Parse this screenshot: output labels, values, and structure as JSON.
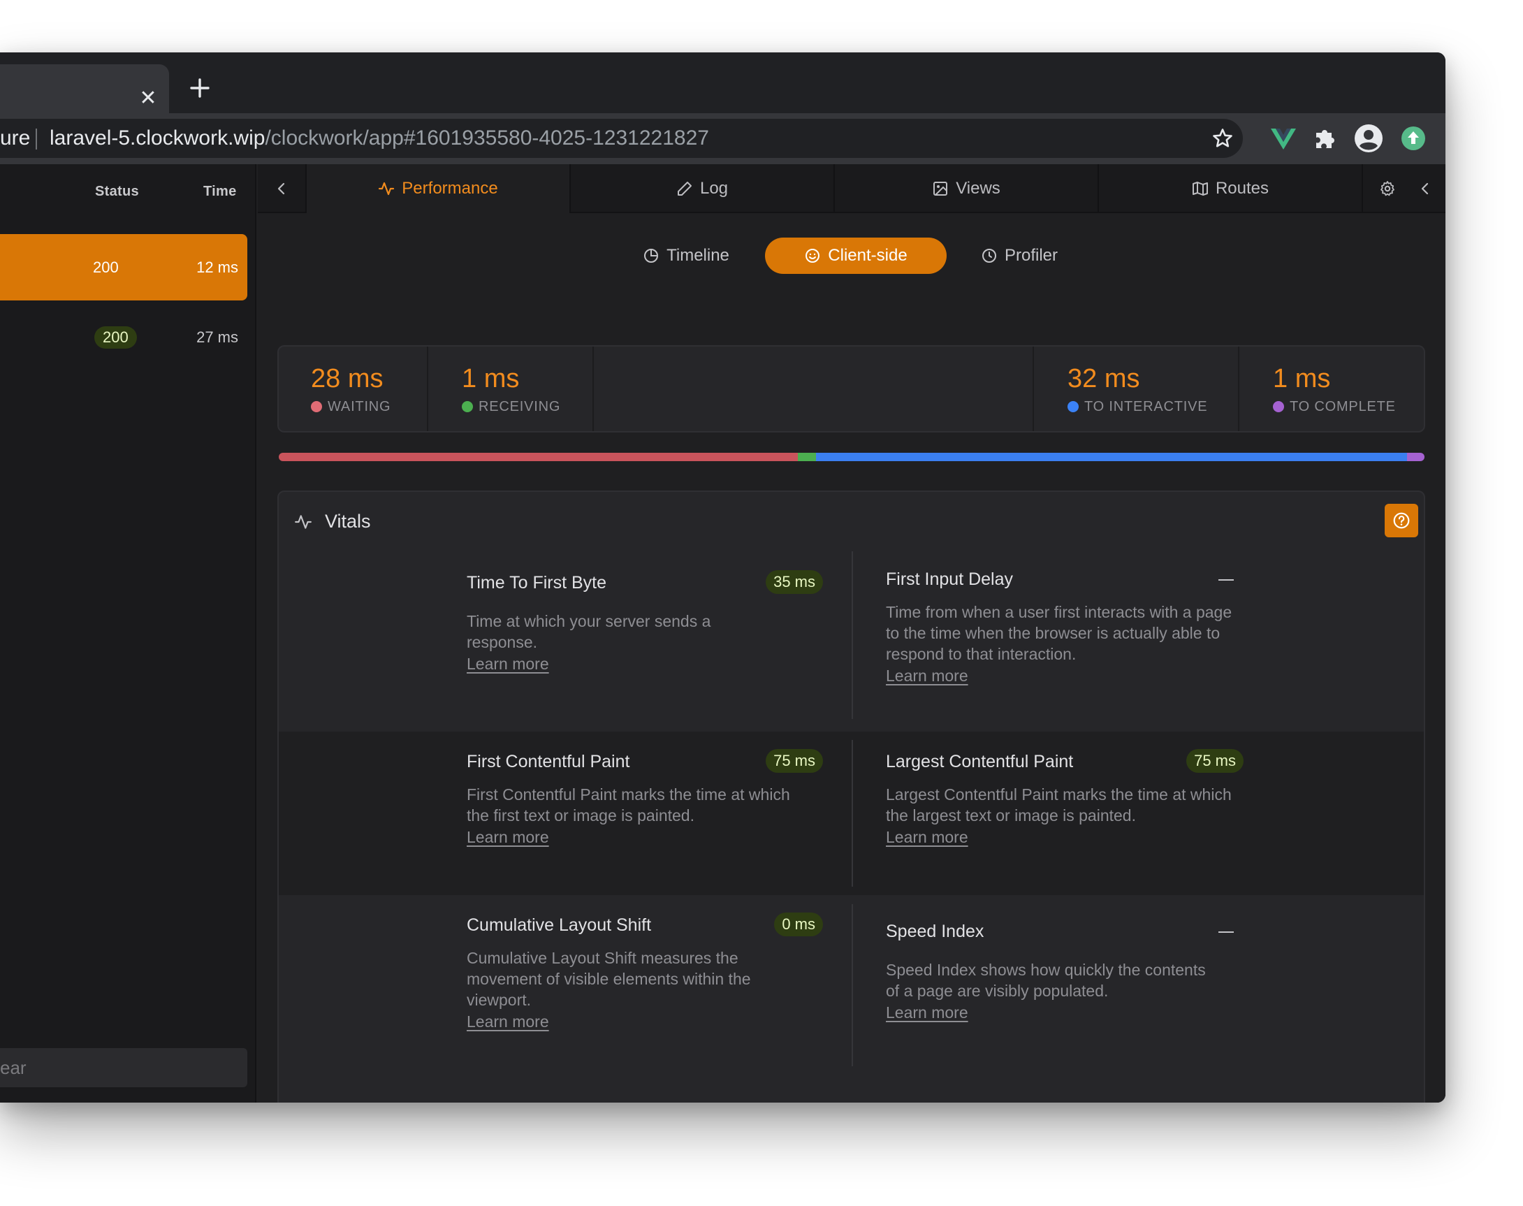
{
  "browser": {
    "new_tab_icon": "plus-icon",
    "close_icon": "close-icon",
    "security_fragment": "ure",
    "url_host": "laravel-5.clockwork.wip",
    "url_path": "/clockwork/app#1601935580-4025-1231221827",
    "extensions": [
      "vue-devtools-icon",
      "puzzle-icon",
      "profile-icon",
      "update-icon"
    ]
  },
  "sidebar": {
    "columns": {
      "status": "Status",
      "time": "Time"
    },
    "requests": [
      {
        "status": "200",
        "time": "12 ms",
        "selected": true
      },
      {
        "status": "200",
        "time": "27 ms",
        "selected": false
      }
    ],
    "search_text": "ear"
  },
  "tabs": {
    "performance": "Performance",
    "log": "Log",
    "views": "Views",
    "routes": "Routes"
  },
  "segments": {
    "timeline": "Timeline",
    "client_side": "Client-side",
    "profiler": "Profiler"
  },
  "metrics": [
    {
      "value": "28 ms",
      "label": "WAITING",
      "color": "#e06c75"
    },
    {
      "value": "1 ms",
      "label": "RECEIVING",
      "color": "#4caf50"
    },
    {
      "value": "32 ms",
      "label": "TO INTERACTIVE",
      "color": "#3b82f6"
    },
    {
      "value": "1 ms",
      "label": "TO COMPLETE",
      "color": "#a562d1"
    }
  ],
  "timing_bar": [
    {
      "share": 0.453,
      "color": "#c9545c"
    },
    {
      "share": 0.016,
      "color": "#4caf50"
    },
    {
      "share": 0.516,
      "color": "#3b7ff0"
    },
    {
      "share": 0.015,
      "color": "#a562d1"
    }
  ],
  "vitals": {
    "title": "Vitals",
    "learn_more": "Learn more",
    "items": [
      {
        "title": "Time To First Byte",
        "value": "35 ms",
        "description": "Time at which your server sends a response."
      },
      {
        "title": "First Input Delay",
        "value": "—",
        "description": "Time from when a user first interacts with a page to the time when the browser is actually able to respond to that interaction."
      },
      {
        "title": "First Contentful Paint",
        "value": "75 ms",
        "description": "First Contentful Paint marks the time at which the first text or image is painted."
      },
      {
        "title": "Largest Contentful Paint",
        "value": "75 ms",
        "description": "Largest Contentful Paint marks the time at which the largest text or image is painted."
      },
      {
        "title": "Cumulative Layout Shift",
        "value": "0 ms",
        "description": "Cumulative Layout Shift measures the movement of visible elements within the viewport."
      },
      {
        "title": "Speed Index",
        "value": "—",
        "description": "Speed Index shows how quickly the contents of a page are visibly populated."
      }
    ]
  },
  "colors": {
    "accent": "#d97706",
    "accent_text": "#f28c1e",
    "badge_good_bg": "#2e3d12"
  }
}
